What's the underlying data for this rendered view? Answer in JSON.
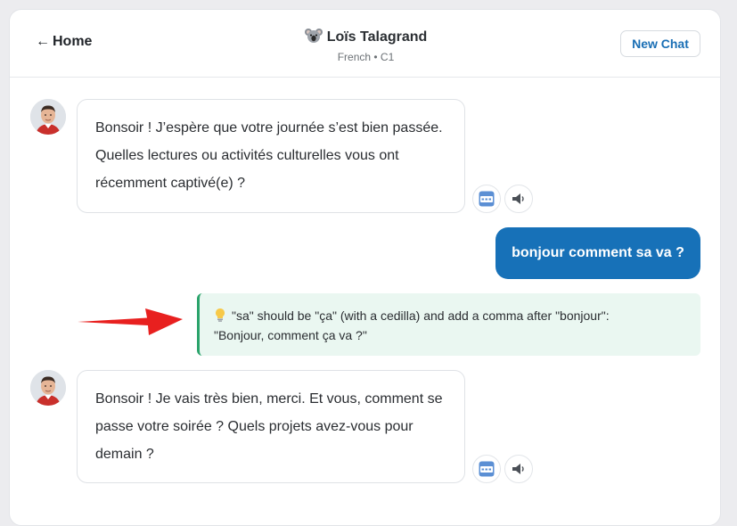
{
  "header": {
    "back_label": "Home",
    "title": "Loïs Talagrand",
    "subtitle": "French • C1",
    "new_chat_label": "New Chat"
  },
  "messages": [
    {
      "role": "assistant",
      "text": "Bonsoir ! J’espère que votre journée s’est bien passée. Quelles lectures ou activités culturelles vous ont récemment captivé(e) ?",
      "actions": [
        "abc-icon",
        "speaker-icon"
      ]
    },
    {
      "role": "user",
      "text": "bonjour comment sa va ?"
    },
    {
      "role": "correction",
      "icon": "lightbulb-icon",
      "text_line1": "\"sa\" should be \"ça\" (with a cedilla) and add a comma after \"bonjour\":",
      "text_line2": "\"Bonjour, comment ça va ?\""
    },
    {
      "role": "assistant",
      "text": "Bonsoir ! Je vais très bien, merci. Et vous, comment se passe votre soirée ? Quels projets avez-vous pour demain ?",
      "actions": [
        "abc-icon",
        "speaker-icon"
      ]
    }
  ],
  "colors": {
    "accent": "#1771b8",
    "correction_bg": "#eaf7f1",
    "correction_border": "#2aa36b",
    "annotation_arrow": "#e8201f"
  },
  "icons": {
    "title_icon": "koala-icon",
    "back_icon": "left-arrow-icon",
    "annotation": "red-arrow-icon"
  }
}
